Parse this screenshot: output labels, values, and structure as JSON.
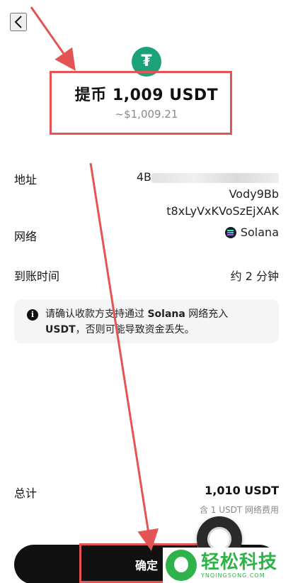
{
  "header": {
    "back_icon": "chevron-left-icon"
  },
  "token": {
    "icon": "tether-icon",
    "symbol_glyph": "₮",
    "color": "#1ba27a"
  },
  "title": "提币 1,009 USDT",
  "subtitle": "~$1,009.21",
  "rows": {
    "address": {
      "label": "地址",
      "value_line1_start": "4B",
      "value_line1_end": "Vo",
      "value_line1_tail": "dy9Bb",
      "value_line2": "t8xLyVxKVoSzEjXAK"
    },
    "network": {
      "label": "网络",
      "value": "Solana",
      "icon": "solana-icon"
    },
    "arrival": {
      "label": "到账时间",
      "value": "约 2 分钟"
    }
  },
  "notice": {
    "icon": "info-icon",
    "text_1": "请确认收款方支持通过 ",
    "bold_1": "Solana",
    "text_2": " 网络充入 ",
    "bold_2": "USDT",
    "text_3": "，否则可能导致资金丢失。"
  },
  "total": {
    "label": "总计",
    "value": "1,010 USDT",
    "fee": "含 1 USDT 网络费用"
  },
  "confirm_label": "确定",
  "watermark": {
    "title": "轻松科技",
    "subtitle": "YNQINGSONG.COM"
  },
  "annotation_color": "#e55454"
}
